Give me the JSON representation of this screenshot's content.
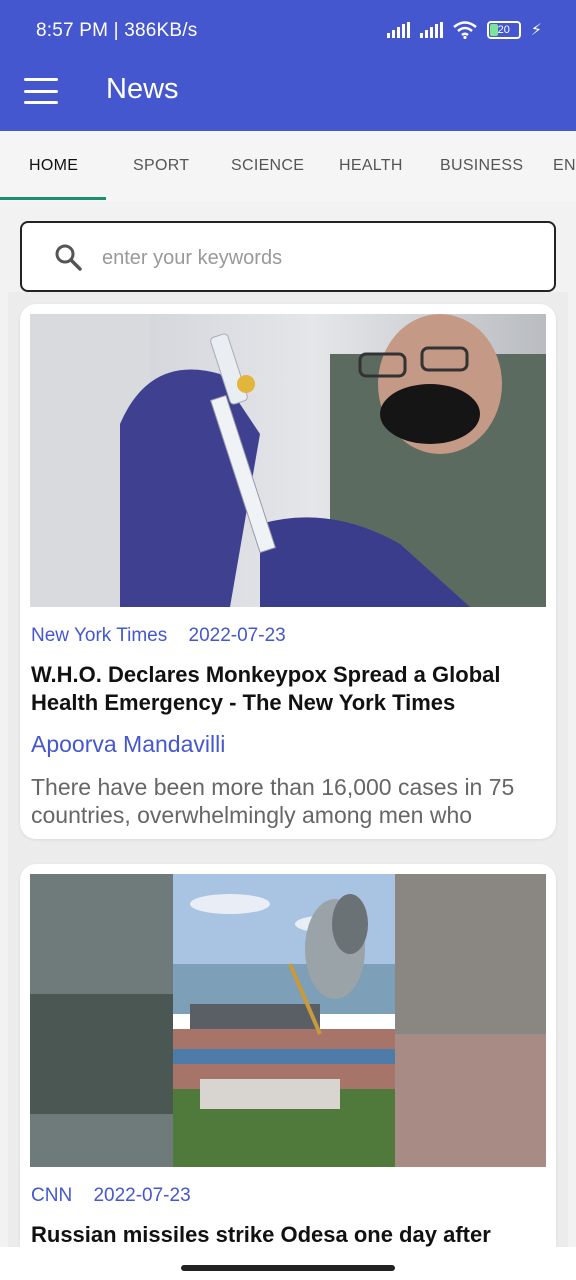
{
  "status_bar": {
    "time": "8:57 PM | 386KB/s",
    "battery": "20"
  },
  "app_bar": {
    "title": "News"
  },
  "tabs": [
    {
      "label": "HOME"
    },
    {
      "label": "SPORT"
    },
    {
      "label": "SCIENCE"
    },
    {
      "label": "HEALTH"
    },
    {
      "label": "BUSINESS"
    },
    {
      "label": "ENTERTAINMENT"
    }
  ],
  "search": {
    "placeholder": "enter your keywords"
  },
  "articles": [
    {
      "source": "New York Times",
      "date": "2022-07-23",
      "title": "W.H.O. Declares Monkeypox Spread a Global Health Emergency - The New York Times",
      "author": "Apoorva Mandavilli",
      "description": "There have been more than 16,000 cases in 75 countries, overwhelmingly among men who"
    },
    {
      "source": "CNN",
      "date": "2022-07-23",
      "title": "Russian missiles strike Odesa one day after",
      "author": "",
      "description": ""
    }
  ]
}
